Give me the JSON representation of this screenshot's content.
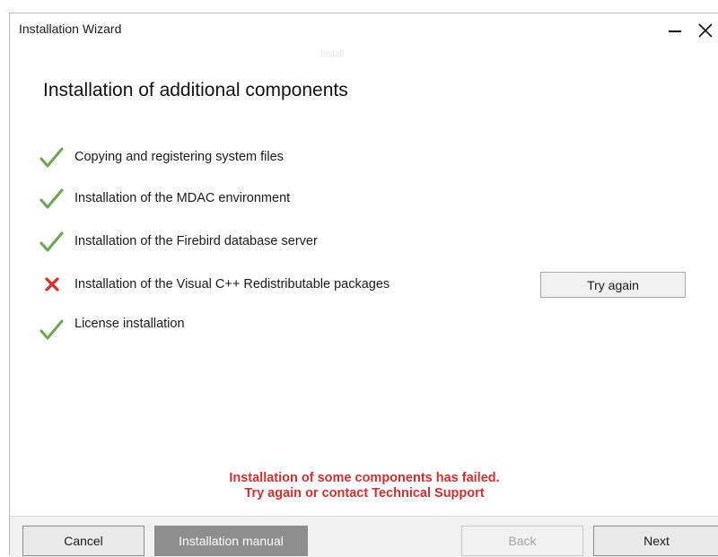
{
  "window": {
    "title": "Installation Wizard",
    "title_ghost": "Install"
  },
  "heading": "Installation of additional components",
  "steps": [
    {
      "label": "Copying and registering system files",
      "status": "done"
    },
    {
      "label": "Installation of the MDAC environment",
      "status": "done"
    },
    {
      "label": "Installation of the Firebird database server",
      "status": "done"
    },
    {
      "label": "Installation of the Visual C++ Redistributable packages",
      "status": "failed"
    },
    {
      "label": "License installation",
      "status": "done"
    }
  ],
  "retry_label": "Try again",
  "error": {
    "line1": "Installation of some components has failed.",
    "line2": "Try again or contact Technical Support"
  },
  "footer": {
    "cancel": "Cancel",
    "manual": "Installation manual",
    "back": "Back",
    "next": "Next"
  },
  "colors": {
    "check": "#6aa84f",
    "cross": "#e02b2b",
    "error_text": "#d2302f"
  },
  "icons": {
    "minimize": "minimize-icon",
    "close": "close-icon",
    "done": "checkmark-icon",
    "failed": "cross-icon"
  }
}
